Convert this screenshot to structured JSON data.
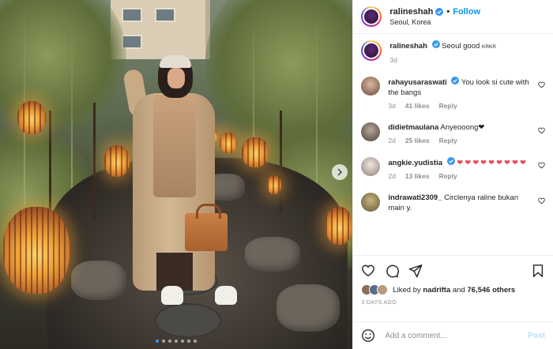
{
  "post": {
    "username": "ralineshah",
    "follow_label": "Follow",
    "bullet": "•",
    "location": "Seoul, Korea",
    "caption_user": "ralineshah",
    "caption_text": "Seoul good",
    "caption_tag": "KRKR",
    "caption_age": "3d"
  },
  "comments": [
    {
      "user": "rahayusaraswati",
      "text": "You look si cute with the bangs",
      "age": "3d",
      "likes": "41 likes",
      "reply": "Reply",
      "verified": true
    },
    {
      "user": "didietmaulana",
      "text": "Anyeooong❤",
      "age": "2d",
      "likes": "25 likes",
      "reply": "Reply",
      "verified": false
    },
    {
      "user": "angkie.yudistia",
      "text": "❤❤❤❤❤❤❤❤❤",
      "age": "2d",
      "likes": "13 likes",
      "reply": "Reply",
      "verified": true
    },
    {
      "user": "indrawati2309_",
      "text": "Circlenya raline bukan main y.",
      "age": "",
      "likes": "",
      "reply": "",
      "verified": false
    }
  ],
  "likes": {
    "prefix": "Liked by",
    "user": "nadrifta",
    "middle": "and",
    "count": "76,546 others"
  },
  "time_ago": "3 DAYS AGO",
  "composer": {
    "placeholder": "Add a comment...",
    "post_label": "Post"
  },
  "colors": {
    "link_blue": "#0095f6",
    "verified_blue": "#3897f0",
    "post_disabled": "#b2dffc"
  },
  "icons": [
    "verified-icon",
    "heart-icon",
    "comment-icon",
    "share-icon",
    "bookmark-icon",
    "emoji-icon",
    "chevron-right-icon"
  ]
}
